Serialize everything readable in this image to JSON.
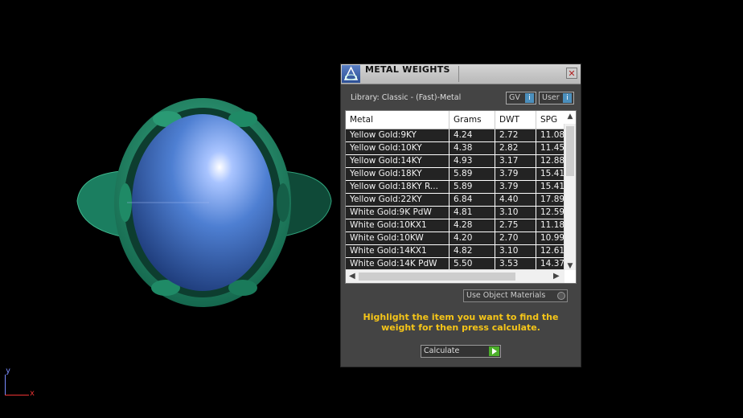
{
  "panel": {
    "title": "METAL WEIGHTS",
    "close_glyph": "✕",
    "library_label": "Library: Classic - (Fast)-Metal",
    "toggles": [
      {
        "label": "GV",
        "button": "i"
      },
      {
        "label": "User",
        "button": "i"
      }
    ],
    "table": {
      "columns": [
        "Metal",
        "Grams",
        "DWT",
        "SPG"
      ],
      "rows": [
        {
          "metal": "Yellow Gold:9KY",
          "grams": "4.24",
          "dwt": "2.72",
          "spg": "11.08"
        },
        {
          "metal": "Yellow Gold:10KY",
          "grams": "4.38",
          "dwt": "2.82",
          "spg": "11.45"
        },
        {
          "metal": "Yellow Gold:14KY",
          "grams": "4.93",
          "dwt": "3.17",
          "spg": "12.88"
        },
        {
          "metal": "Yellow Gold:18KY",
          "grams": "5.89",
          "dwt": "3.79",
          "spg": "15.41"
        },
        {
          "metal": "Yellow Gold:18KY R...",
          "grams": "5.89",
          "dwt": "3.79",
          "spg": "15.41"
        },
        {
          "metal": "Yellow Gold:22KY",
          "grams": "6.84",
          "dwt": "4.40",
          "spg": "17.89"
        },
        {
          "metal": "White Gold:9K PdW",
          "grams": "4.81",
          "dwt": "3.10",
          "spg": "12.59"
        },
        {
          "metal": "White Gold:10KX1",
          "grams": "4.28",
          "dwt": "2.75",
          "spg": "11.18"
        },
        {
          "metal": "White Gold:10KW",
          "grams": "4.20",
          "dwt": "2.70",
          "spg": "10.99"
        },
        {
          "metal": "White Gold:14KX1",
          "grams": "4.82",
          "dwt": "3.10",
          "spg": "12.61"
        },
        {
          "metal": "White Gold:14K PdW",
          "grams": "5.50",
          "dwt": "3.53",
          "spg": "14.37"
        }
      ]
    },
    "use_object_materials": "Use Object Materials",
    "instruction": "Highlight the item you want to find the weight for then press calculate.",
    "calculate_label": "Calculate"
  },
  "viewport": {
    "axis": {
      "y": "y",
      "x": "x"
    },
    "colors": {
      "ring": "#1e8a68",
      "stone": "#4a78c8",
      "background": "#000000"
    }
  },
  "icons": [
    "app-logo-icon",
    "close-icon",
    "info-icon",
    "radio-icon",
    "play-icon",
    "chevron-up-icon",
    "chevron-down-icon",
    "chevron-left-icon",
    "chevron-right-icon"
  ]
}
